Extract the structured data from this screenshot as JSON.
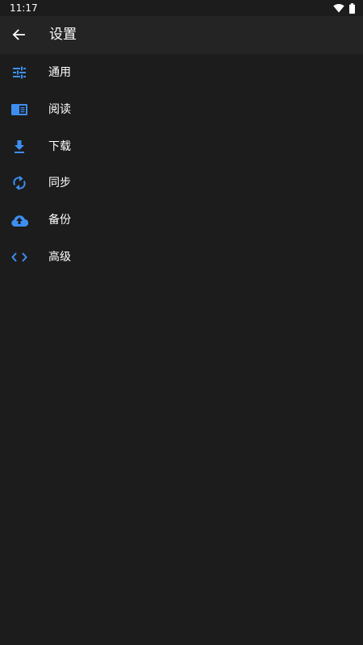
{
  "status_bar": {
    "time": "11:17"
  },
  "app_bar": {
    "title": "设置"
  },
  "menu": {
    "items": [
      {
        "label": "通用",
        "icon": "tune-icon"
      },
      {
        "label": "阅读",
        "icon": "chrome-reader-mode-icon"
      },
      {
        "label": "下载",
        "icon": "download-icon"
      },
      {
        "label": "同步",
        "icon": "sync-icon"
      },
      {
        "label": "备份",
        "icon": "cloud-upload-icon"
      },
      {
        "label": "高级",
        "icon": "code-icon"
      }
    ]
  },
  "colors": {
    "background": "#1c1c1c",
    "app_bar": "#242424",
    "accent": "#3d8ef0",
    "text": "#ffffff"
  }
}
